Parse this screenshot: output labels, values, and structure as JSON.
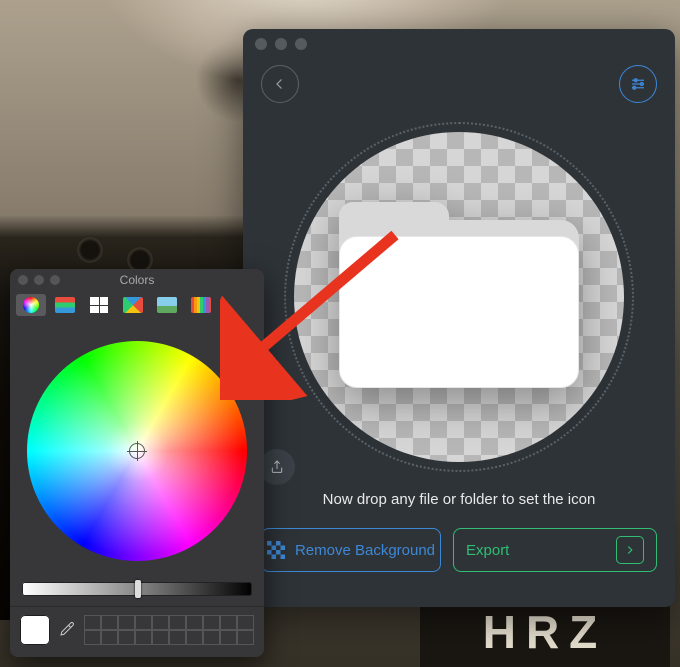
{
  "wallpaper": {
    "plate_text": "HRZ"
  },
  "app": {
    "hint": "Now drop any file or folder to set the icon",
    "remove_bg_label": "Remove Background",
    "export_label": "Export"
  },
  "colors_panel": {
    "title": "Colors",
    "tabs": [
      "wheel",
      "sliders",
      "palette",
      "spectrum",
      "image",
      "pencils"
    ],
    "selected_tab": "wheel",
    "current_swatch": "#ffffff",
    "brightness": 0.5,
    "saved_swatches_count": 20
  },
  "colors": {
    "accent_blue": "#3d88d6",
    "accent_green": "#2fbe72",
    "arrow_red": "#e8341f"
  }
}
